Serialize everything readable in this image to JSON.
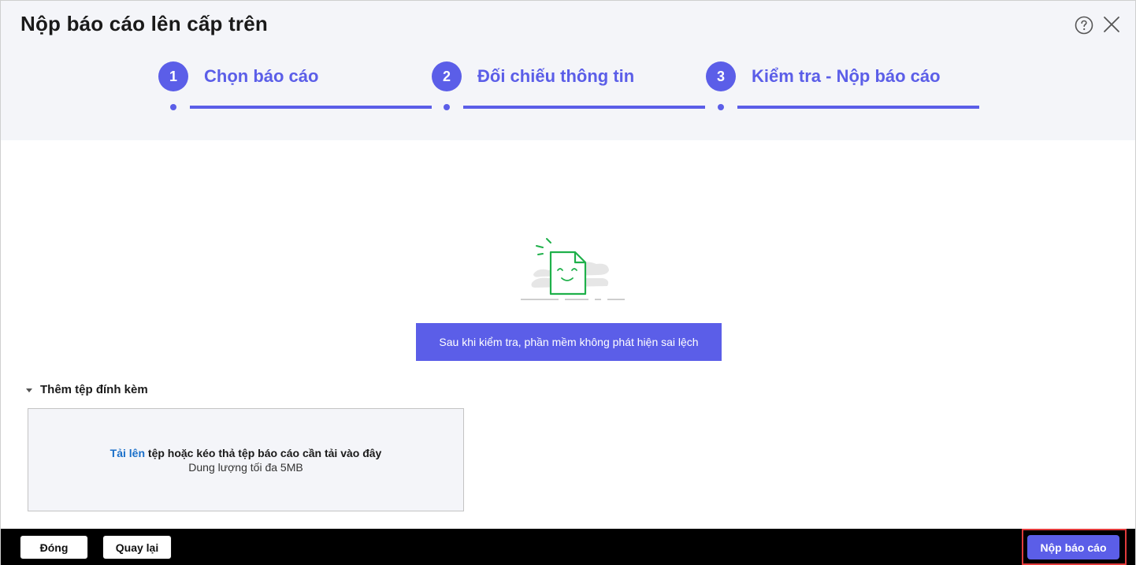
{
  "dialog": {
    "title": "Nộp báo cáo lên cấp trên",
    "help_icon": "help-circle-icon",
    "close_icon": "close-icon"
  },
  "steps": [
    {
      "number": "1",
      "label": "Chọn báo cáo"
    },
    {
      "number": "2",
      "label": "Đối chiếu thông tin"
    },
    {
      "number": "3",
      "label": "Kiểm tra - Nộp báo cáo"
    }
  ],
  "result": {
    "illustration_icon": "happy-document-icon",
    "message": "Sau khi kiểm tra, phần mềm không phát hiện sai lệch"
  },
  "attachments": {
    "toggle_label": "Thêm tệp đính kèm",
    "upload_link": "Tải lên",
    "upload_text": " tệp hoặc kéo thả tệp báo cáo cần tải vào đây",
    "size_limit": "Dung lượng tối đa 5MB"
  },
  "footer": {
    "close_label": "Đóng",
    "back_label": "Quay lại",
    "submit_label": "Nộp báo cáo"
  },
  "colors": {
    "accent": "#5b5ee8",
    "header_bg": "#f4f5f9",
    "footer_bg": "#000000",
    "highlight": "#e23b3b",
    "illustration": "#1fb04a"
  }
}
